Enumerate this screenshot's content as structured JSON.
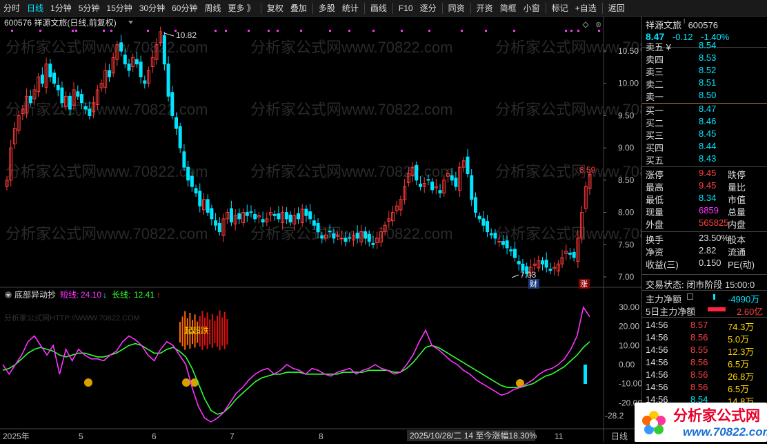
{
  "toolbar": [
    "分时",
    "日线",
    "1分钟",
    "5分钟",
    "15分钟",
    "30分钟",
    "60分钟",
    "周线",
    "更多 》",
    "复权",
    "叠加",
    "多股",
    "统计",
    "画线",
    "F10",
    "逐分",
    "同资",
    "开资",
    "简框",
    "小窗",
    "标记",
    "+自选",
    "返回"
  ],
  "toolbar_active": "日线",
  "chart": {
    "title": "600576 祥源文旅(日线,前复权)",
    "max_label": "10.82",
    "min_label": "7.03",
    "last_label": "8.59",
    "y_ticks": [
      "10.50",
      "10.00",
      "9.50",
      "9.00",
      "8.50",
      "8.00",
      "7.50",
      "7.00"
    ],
    "x_ticks": [
      "2025年",
      "5",
      "6",
      "7",
      "8",
      "11",
      "日线"
    ],
    "status": "2025/10/28/二 14 至今涨幅18.30%",
    "badge_cai": "财",
    "badge_zhang": "涨",
    "watermark": "分析家公式网www.70822.com"
  },
  "indicator": {
    "name": "底部异动抄",
    "short_label": "短线:",
    "short_val": "24.10",
    "short_arrow": "↓",
    "long_label": "长线:",
    "long_val": "12.41",
    "long_arrow": "↑",
    "wm": "分析家公式网HTTP://WWW.70822.COM",
    "signal": "起超跌",
    "y_ticks": [
      "30.00",
      "20.00",
      "10.00",
      "0.00",
      "-10.00",
      "-20.00",
      "-28.2"
    ],
    "colors": {
      "short": "#ff33ff",
      "long": "#33ff33"
    }
  },
  "quote": {
    "name": "祥源文旅",
    "code": "600576",
    "price": "8.47",
    "change": "-0.12",
    "pct": "-1.40%",
    "asks": [
      [
        "卖五 ¥",
        "8.54"
      ],
      [
        "卖四",
        "8.53"
      ],
      [
        "卖三",
        "8.52"
      ],
      [
        "卖二",
        "8.51"
      ],
      [
        "卖一",
        "8.50"
      ]
    ],
    "bids": [
      [
        "买一",
        "8.47"
      ],
      [
        "买二",
        "8.46"
      ],
      [
        "买三",
        "8.45"
      ],
      [
        "买四",
        "8.44"
      ],
      [
        "买五",
        "8.43"
      ]
    ],
    "stats": [
      [
        "涨停",
        "9.45",
        "跌停"
      ],
      [
        "最高",
        "9.45",
        "量比"
      ],
      [
        "最低",
        "8.34",
        "市值"
      ],
      [
        "现量",
        "6859",
        "总量"
      ],
      [
        "外盘",
        "565825",
        "内盘"
      ],
      [
        "换手",
        "23.50%",
        "股本"
      ],
      [
        "净资",
        "2.82",
        "流通"
      ],
      [
        "收益(三)",
        "0.150",
        "PE(动)"
      ]
    ],
    "status": "交易状态: 闭市阶段 15:00:0",
    "main_flow_label": "主力净额",
    "main_flow_val": "-4990万",
    "flow5_label": "5日主力净额",
    "flow5_val": "2.60亿",
    "ticks": [
      [
        "14:56",
        "8.57",
        "74.3万"
      ],
      [
        "14:56",
        "8.56",
        "5.0万"
      ],
      [
        "14:56",
        "8.55",
        "12.3万"
      ],
      [
        "14:56",
        "8.56",
        "6.5万"
      ],
      [
        "14:56",
        "8.56",
        "26.8万"
      ],
      [
        "14:56",
        "8.56",
        "6.5万"
      ],
      [
        "14:56",
        "8.54",
        "14.8万"
      ]
    ]
  },
  "logo_text": "分析家公式网",
  "logo_url": "www.70822.com"
}
